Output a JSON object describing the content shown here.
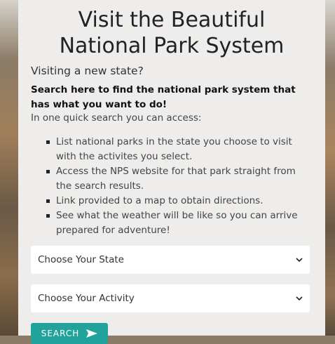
{
  "header": {
    "title_line1": "Visit the Beautiful",
    "title_line2": "National Park System"
  },
  "intro": {
    "subheading": "Visiting a new state?",
    "bold_text": "Search here to find the national park system that has what you want to do!",
    "lead": "In one quick search you can access:",
    "features": [
      "List national parks in the state you choose to visit with the activites you select.",
      "Access the NPS website for that park straight from the search results.",
      "Link provided to a map to obtain directions.",
      "See what the weather will be like so you can arrive prepared for adventure!"
    ]
  },
  "form": {
    "state_select": "Choose Your State",
    "activity_select": "Choose Your Activity",
    "search_label": "SEARCH",
    "search_icon": "send-icon"
  },
  "colors": {
    "panel_bg": "#eeedec",
    "button_bg": "#21a39c"
  }
}
